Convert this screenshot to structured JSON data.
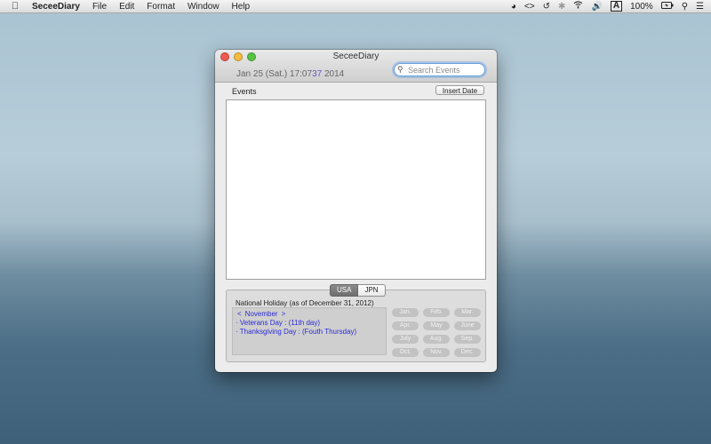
{
  "menubar": {
    "app_name": "SeceeDiary",
    "items": [
      "File",
      "Edit",
      "Format",
      "Window",
      "Help"
    ],
    "battery": "100%"
  },
  "window": {
    "title": "SeceeDiary",
    "date_prefix": "Jan 25 (Sat.) 17:07",
    "week_number": "37",
    "year": "2014",
    "search_placeholder": "Search Events",
    "events_label": "Events",
    "insert_date_label": "Insert Date"
  },
  "holidays": {
    "tabs": [
      "USA",
      "JPN"
    ],
    "selected_tab": "USA",
    "caption": "National Holiday  (as of December 31, 2012)",
    "prev_symbol": "<",
    "month_label": "November",
    "next_symbol": ">",
    "items": [
      "· Veterans Day : (11th day)",
      "· Thanksgiving Day : (Fouth Thursday)"
    ],
    "months": [
      "Jan.",
      "Feb.",
      "Mar.",
      "Apr.",
      "May",
      "June",
      "July",
      "Aug.",
      "Sep.",
      "Oct.",
      "Nov.",
      "Dec."
    ]
  }
}
